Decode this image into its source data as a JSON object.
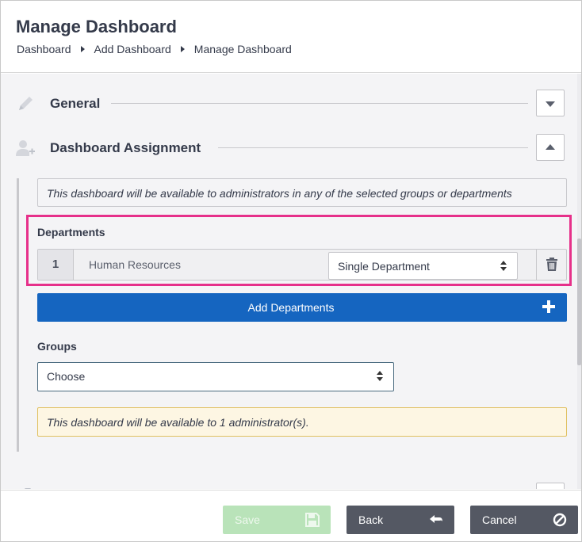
{
  "header": {
    "title": "Manage Dashboard",
    "breadcrumb": [
      "Dashboard",
      "Add Dashboard",
      "Manage Dashboard"
    ]
  },
  "sections": {
    "general": {
      "title": "General",
      "icon": "pencil-icon",
      "expanded": false
    },
    "assignment": {
      "title": "Dashboard Assignment",
      "icon": "user-add-icon",
      "expanded": true
    }
  },
  "assignment": {
    "info_text": "This dashboard will be available to administrators in any of the selected groups or departments",
    "departments_label": "Departments",
    "departments": [
      {
        "index": "1",
        "name": "Human Resources",
        "scope": "Single Department"
      }
    ],
    "add_departments_label": "Add Departments",
    "groups_label": "Groups",
    "groups_select_value": "Choose",
    "availability_text": "This dashboard will be available to 1 administrator(s)."
  },
  "footer": {
    "save_label": "Save",
    "back_label": "Back",
    "cancel_label": "Cancel"
  },
  "colors": {
    "primary": "#1565c0",
    "highlight": "#e6308a",
    "save_disabled": "#b9e3b9",
    "dark_button": "#545863",
    "warning_bg": "#fdf6e3",
    "warning_border": "#e0c060"
  }
}
